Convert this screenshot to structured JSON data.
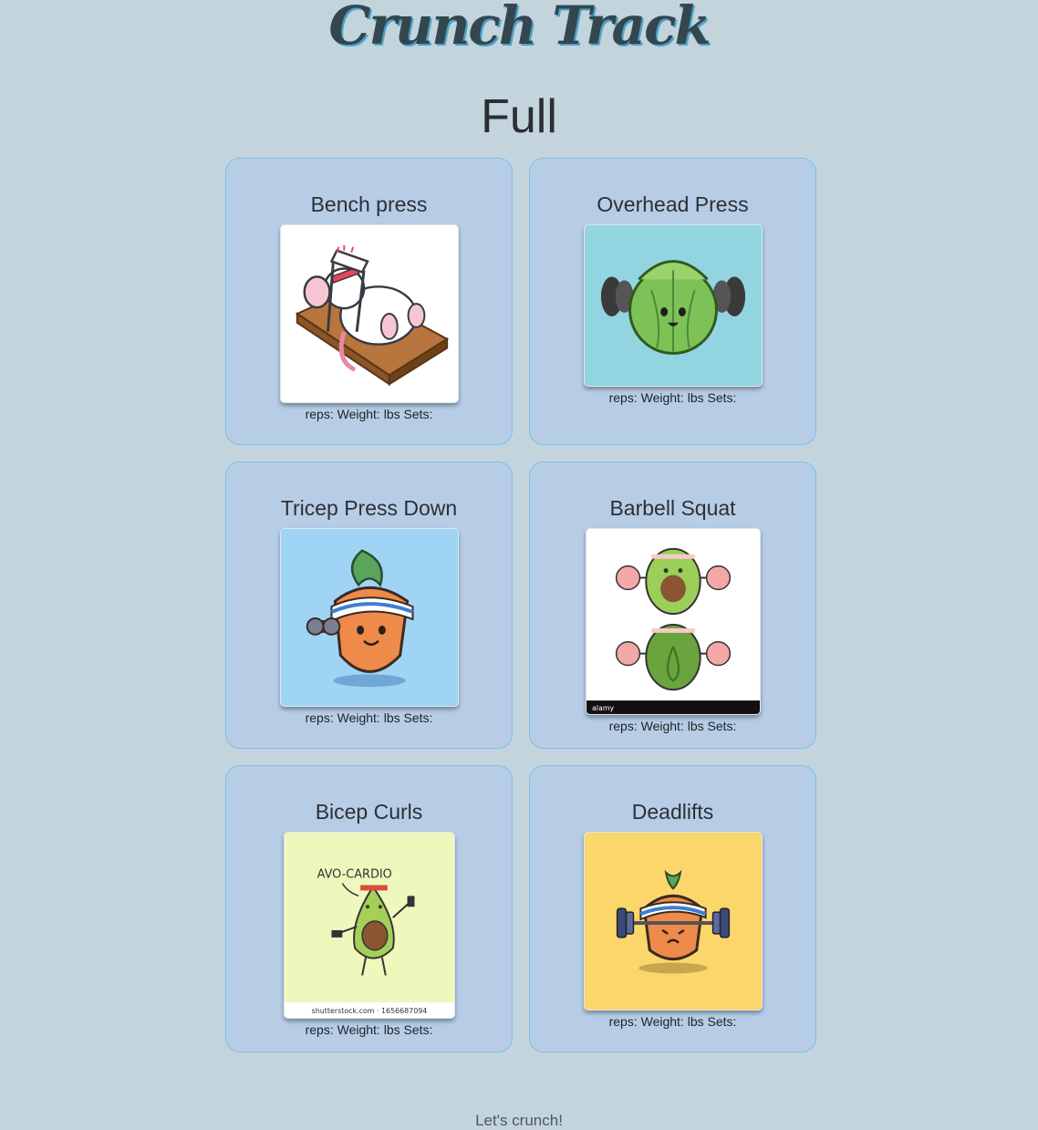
{
  "app_title": "Crunch Track",
  "routine_title": "Full",
  "exercises": [
    {
      "name": "Bench press",
      "stats": "reps: Weight: lbs Sets:",
      "image_icon": "mouse-bench-press-icon",
      "image_bg": "#ffffff"
    },
    {
      "name": "Overhead Press",
      "stats": "reps: Weight: lbs Sets:",
      "image_icon": "lettuce-barbell-icon",
      "image_bg": "#92d5e0"
    },
    {
      "name": "Tricep Press Down",
      "stats": "reps: Weight: lbs Sets:",
      "image_icon": "carrot-dumbbell-icon",
      "image_bg": "#9fd4f5"
    },
    {
      "name": "Barbell Squat",
      "stats": "reps: Weight: lbs Sets:",
      "image_icon": "avocado-squat-icon",
      "image_bg": "#ffffff",
      "image_text": "alamy"
    },
    {
      "name": "Bicep Curls",
      "stats": "reps: Weight: lbs Sets:",
      "image_icon": "avocado-cardio-icon",
      "image_bg": "#eff7bd",
      "image_text": "AVO-CARDIO",
      "image_caption": "shutterstock.com · 1656687094"
    },
    {
      "name": "Deadlifts",
      "stats": "reps: Weight: lbs Sets:",
      "image_icon": "carrot-deadlift-icon",
      "image_bg": "#fbd76b"
    }
  ],
  "footer": "Let's crunch!",
  "colors": {
    "background": "#c3d4dc",
    "card": "#b7cde6",
    "card_border": "#79c0ec",
    "title_shadow": "#4aa3c7"
  }
}
